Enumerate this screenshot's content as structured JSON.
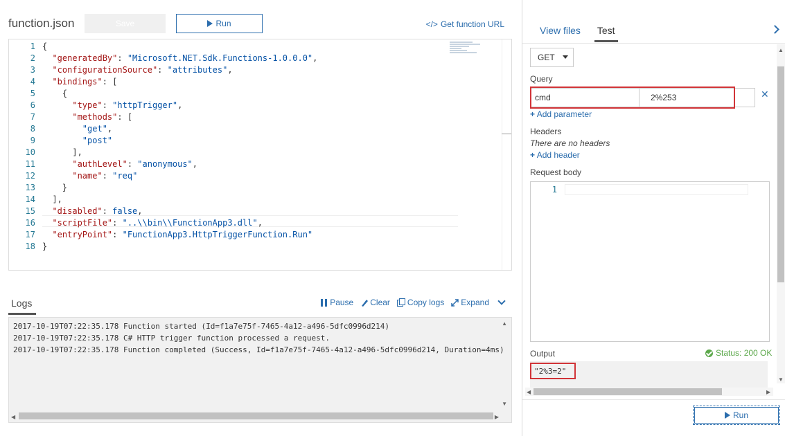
{
  "editor": {
    "filename": "function.json",
    "save_label": "Save",
    "run_label": "Run",
    "get_url_icon": "</>",
    "get_url_label": "Get function URL",
    "lines": [
      {
        "n": "1",
        "html": "<span class='p'>{</span>"
      },
      {
        "n": "2",
        "html": "  <span class='k'>\"generatedBy\"</span><span class='p'>: </span><span class='s'>\"Microsoft.NET.Sdk.Functions-1.0.0.0\"</span><span class='p'>,</span>"
      },
      {
        "n": "3",
        "html": "  <span class='k'>\"configurationSource\"</span><span class='p'>: </span><span class='s'>\"attributes\"</span><span class='p'>,</span>"
      },
      {
        "n": "4",
        "html": "  <span class='k'>\"bindings\"</span><span class='p'>: [</span>"
      },
      {
        "n": "5",
        "html": "    <span class='p'>{</span>"
      },
      {
        "n": "6",
        "html": "      <span class='k'>\"type\"</span><span class='p'>: </span><span class='s'>\"httpTrigger\"</span><span class='p'>,</span>"
      },
      {
        "n": "7",
        "html": "      <span class='k'>\"methods\"</span><span class='p'>: [</span>"
      },
      {
        "n": "8",
        "html": "        <span class='s'>\"get\"</span><span class='p'>,</span>"
      },
      {
        "n": "9",
        "html": "        <span class='s'>\"post\"</span>"
      },
      {
        "n": "10",
        "html": "      <span class='p'>],</span>"
      },
      {
        "n": "11",
        "html": "      <span class='k'>\"authLevel\"</span><span class='p'>: </span><span class='s'>\"anonymous\"</span><span class='p'>,</span>"
      },
      {
        "n": "12",
        "html": "      <span class='k'>\"name\"</span><span class='p'>: </span><span class='s'>\"req\"</span>"
      },
      {
        "n": "13",
        "html": "    <span class='p'>}</span>"
      },
      {
        "n": "14",
        "html": "  <span class='p'>],</span>"
      },
      {
        "n": "15",
        "html": "  <span class='k'>\"disabled\"</span><span class='p'>: </span><span class='s'>false</span><span class='p'>,</span>"
      },
      {
        "n": "16",
        "html": "  <span class='k'>\"scriptFile\"</span><span class='p'>: </span><span class='s'>\"..\\\\bin\\\\FunctionApp3.dll\"</span><span class='p'>,</span>"
      },
      {
        "n": "17",
        "html": "  <span class='k'>\"entryPoint\"</span><span class='p'>: </span><span class='s'>\"FunctionApp3.HttpTriggerFunction.Run\"</span>"
      },
      {
        "n": "18",
        "html": "<span class='p'>}</span>"
      }
    ]
  },
  "logs": {
    "tab_label": "Logs",
    "pause_label": "Pause",
    "clear_label": "Clear",
    "copy_label": "Copy logs",
    "expand_label": "Expand",
    "lines": [
      "2017-10-19T07:22:35.178 Function started (Id=f1a7e75f-7465-4a12-a496-5dfc0996d214)",
      "2017-10-19T07:22:35.178 C# HTTP trigger function processed a request.",
      "2017-10-19T07:22:35.178 Function completed (Success, Id=f1a7e75f-7465-4a12-a496-5dfc0996d214, Duration=4ms)"
    ]
  },
  "test_panel": {
    "tabs": [
      "View files",
      "Test"
    ],
    "active_tab": "Test",
    "method": "GET",
    "query_label": "Query",
    "query_key": "cmd",
    "query_value": "2%253",
    "add_parameter": "Add parameter",
    "headers_label": "Headers",
    "no_headers": "There are no headers",
    "add_header": "Add header",
    "request_body_label": "Request body",
    "request_body_line": "1",
    "output_label": "Output",
    "status": "Status: 200 OK",
    "output_value": "\"2%3=2\"",
    "run_label": "Run"
  },
  "colors": {
    "accent": "#2b6dad",
    "highlight": "#d13438",
    "success": "#5ca84b"
  }
}
